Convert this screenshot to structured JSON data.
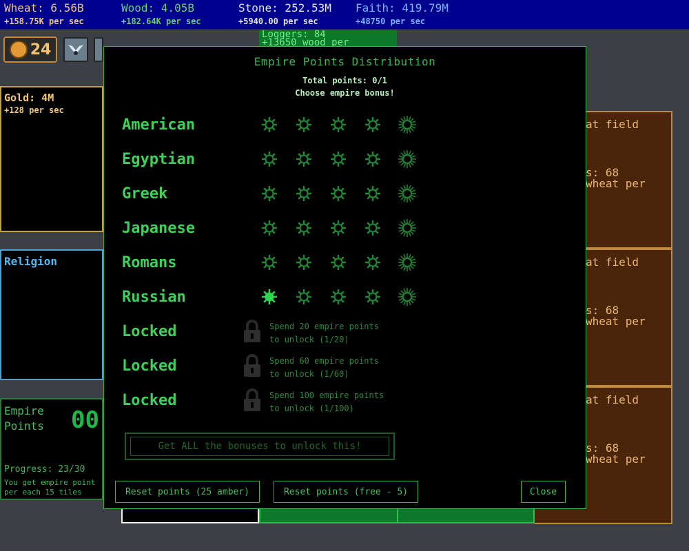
{
  "resources": [
    {
      "name": "Wheat: 6.56B",
      "rate": "+158.75K per sec",
      "color": "#f0c67a"
    },
    {
      "name": "Wood: 4.05B",
      "rate": "+182.64K per sec",
      "color": "#66d06a"
    },
    {
      "name": "Stone: 252.53M",
      "rate": "+5940.00 per sec",
      "color": "#e6e6e6"
    },
    {
      "name": "Faith: 419.79M",
      "rate": "+48750 per sec",
      "color": "#7ab6ff"
    }
  ],
  "coin_count": "24",
  "loggers": {
    "line1": "Loggers: 84",
    "line2": "+13650 wood per"
  },
  "gold": {
    "title": "Gold: 4M",
    "rate": "+128 per sec"
  },
  "religion": {
    "title": "Religion"
  },
  "empire_panel": {
    "title": "Empire Points",
    "value": "00",
    "progress": "Progress: 23/30",
    "info_line1": "You get empire point",
    "info_line2": "per each 15 tiles"
  },
  "fields": [
    {
      "title": "at field",
      "stat": "s: 68",
      "wheat": "wheat per"
    },
    {
      "title": "at field",
      "stat": "s: 68",
      "wheat": "wheat per"
    },
    {
      "title": "at field",
      "stat": "s: 68",
      "wheat": "wheat per"
    }
  ],
  "modal": {
    "title": "Empire Points Distribution",
    "total": "Total points: 0/1",
    "choose": "Choose empire bonus!",
    "empires": [
      {
        "name": "American",
        "filled": 0
      },
      {
        "name": "Egyptian",
        "filled": 0
      },
      {
        "name": "Greek",
        "filled": 0
      },
      {
        "name": "Japanese",
        "filled": 0
      },
      {
        "name": "Romans",
        "filled": 0
      },
      {
        "name": "Russian",
        "filled": 1
      }
    ],
    "locked": [
      {
        "name": "Locked",
        "line1": "Spend 20 empire points",
        "line2": "to unlock (1/20)"
      },
      {
        "name": "Locked",
        "line1": "Spend 60 empire points",
        "line2": "to unlock (1/60)"
      },
      {
        "name": "Locked",
        "line1": "Spend 100 empire points",
        "line2": "to unlock (1/100)"
      }
    ],
    "all_bonus": "Get ALL the bonuses to unlock this!",
    "btn_reset_amber": "Reset points (25 amber)",
    "btn_reset_free": "Reset points (free - 5)",
    "btn_close": "Close"
  },
  "colors": {
    "accent_green": "#3ed05a",
    "sun_dim": "#1f8a34",
    "sun_lit": "#2bd94e",
    "topbar_bg": "#00008e",
    "field_bg": "#4a2509"
  }
}
